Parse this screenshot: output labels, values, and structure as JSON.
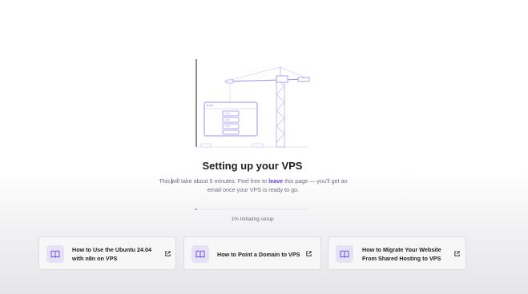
{
  "page": {
    "title": "Setting up your VPS",
    "subtitle_before": "This will take about 5 minutes. Feel free to ",
    "subtitle_link": "leave",
    "subtitle_after": " this page — you'll get an email once your VPS is ready to go."
  },
  "progress": {
    "value_percent": 1,
    "label": "1% Initiating setup"
  },
  "cards": [
    {
      "title": "How to Use the Ubuntu 24.04 with n8n on VPS",
      "icon": "book-icon",
      "action_icon": "external-link-icon"
    },
    {
      "title": "How to Point a Domain to VPS",
      "icon": "book-icon",
      "action_icon": "external-link-icon"
    },
    {
      "title": "How to Migrate Your Website From Shared Hosting to VPS",
      "icon": "book-icon",
      "action_icon": "external-link-icon"
    }
  ],
  "colors": {
    "accent": "#673de6",
    "text": "#1d1e20",
    "muted": "#6d6d80",
    "illustration": "#9d8ef0"
  }
}
